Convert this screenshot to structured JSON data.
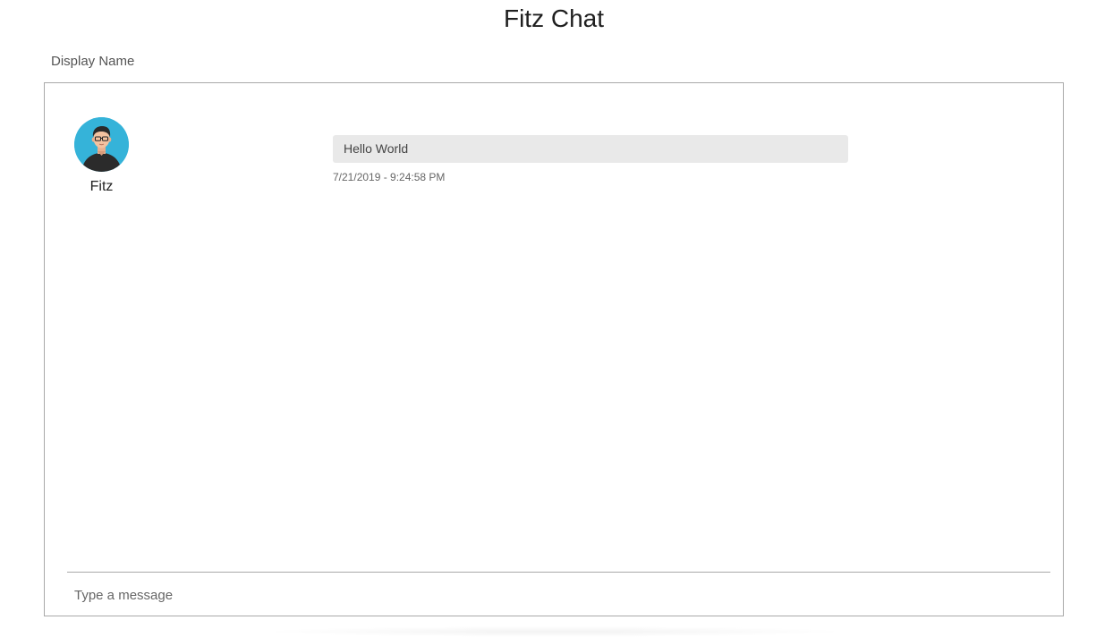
{
  "app": {
    "title": "Fitz Chat"
  },
  "display_name": {
    "placeholder": "Display Name"
  },
  "messages": [
    {
      "author": "Fitz",
      "avatar_icon": "user-avatar-icon",
      "text": "Hello World",
      "timestamp": "7/21/2019 - 9:24:58 PM"
    }
  ],
  "composer": {
    "placeholder": "Type a message"
  },
  "colors": {
    "avatar_background": "#35b3d9",
    "bubble_background": "#e9e9e9",
    "border": "#a9a9a9"
  }
}
